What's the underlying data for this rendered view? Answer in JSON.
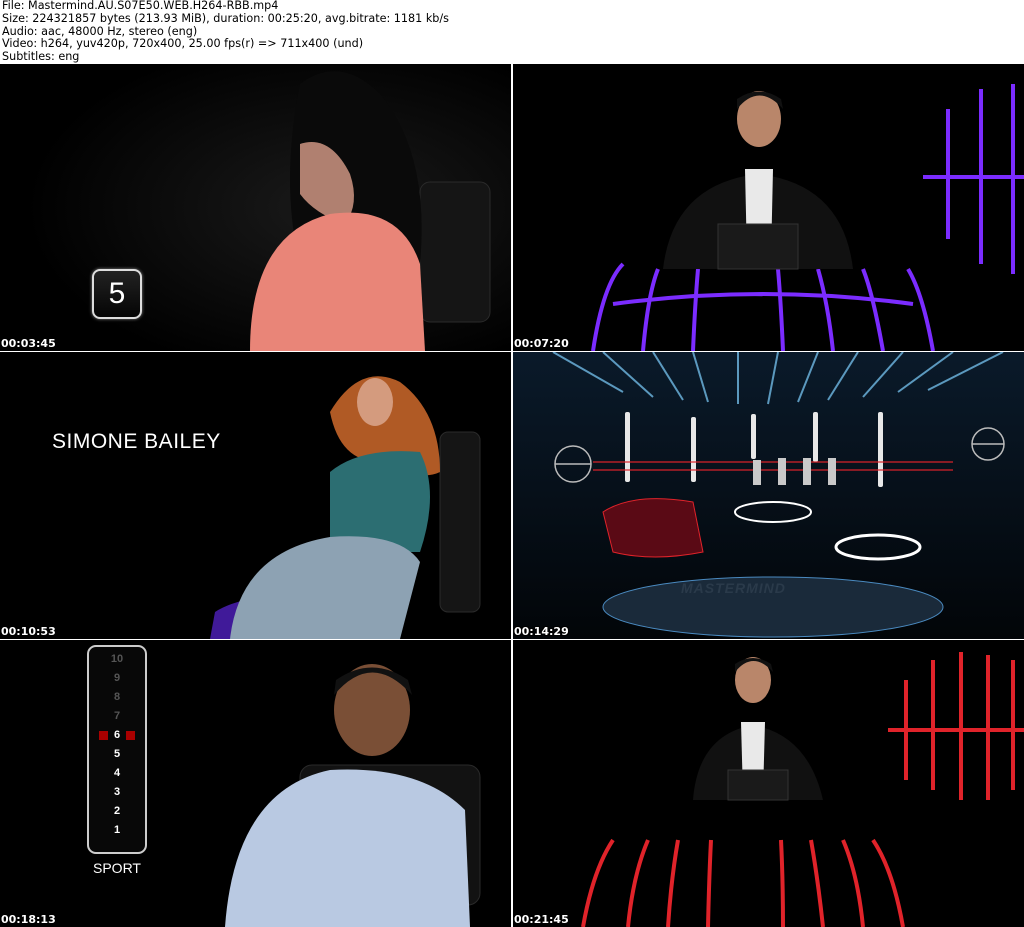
{
  "header": {
    "file": "File: Mastermind.AU.S07E50.WEB.H264-RBB.mp4",
    "size": "Size: 224321857 bytes (213.93 MiB), duration: 00:25:20, avg.bitrate: 1181 kb/s",
    "audio": "Audio: aac, 48000 Hz, stereo (eng)",
    "video": "Video: h264, yuv420p, 720x400, 25.00 fps(r) => 711x400 (und)",
    "subtitles": "Subtitles: eng"
  },
  "thumbnails": [
    {
      "timestamp": "00:03:45",
      "overlay": "5"
    },
    {
      "timestamp": "00:07:20"
    },
    {
      "timestamp": "00:10:53",
      "overlay": "SIMONE BAILEY"
    },
    {
      "timestamp": "00:14:29",
      "overlay": "MASTERMIND"
    },
    {
      "timestamp": "00:18:13",
      "overlay": "SPORT",
      "score_numbers": [
        "10",
        "9",
        "8",
        "7",
        "6",
        "5",
        "4",
        "3",
        "2",
        "1"
      ]
    },
    {
      "timestamp": "00:21:45"
    }
  ],
  "colors": {
    "purple": "#7b2cff",
    "red": "#e0232a",
    "blue_light": "#7fd0ff"
  }
}
